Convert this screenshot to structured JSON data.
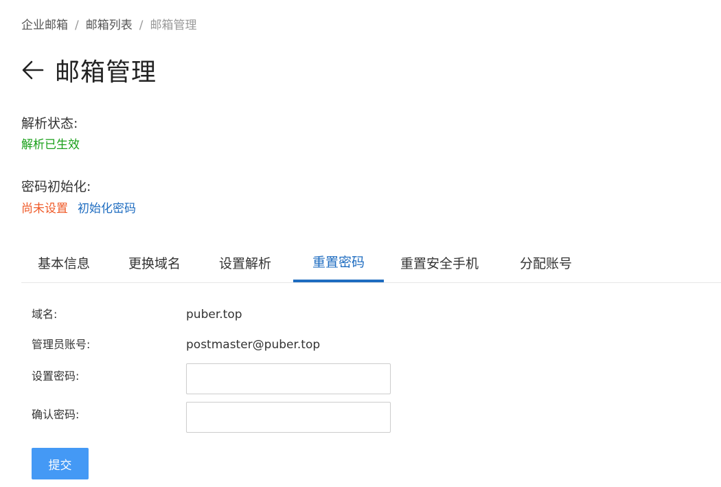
{
  "breadcrumb": {
    "items": [
      "企业邮箱",
      "邮箱列表",
      "邮箱管理"
    ],
    "separator": "/"
  },
  "page": {
    "title": "邮箱管理",
    "back_icon": "arrow-left-icon"
  },
  "resolve_status": {
    "label": "解析状态:",
    "value": "解析已生效",
    "value_color": "#19a019"
  },
  "password_init": {
    "label": "密码初始化:",
    "status": "尚未设置",
    "status_color": "#ef5a28",
    "action_link": "初始化密码"
  },
  "tabs": {
    "items": [
      "基本信息",
      "更换域名",
      "设置解析",
      "重置密码",
      "重置安全手机",
      "分配账号"
    ],
    "active": "重置密码",
    "accent_color": "#1e6cc0"
  },
  "form": {
    "domain_label": "域名:",
    "domain_value": "puber.top",
    "admin_label": "管理员账号:",
    "admin_value": "postmaster@puber.top",
    "password_label": "设置密码:",
    "password_value": "",
    "confirm_label": "确认密码:",
    "confirm_value": "",
    "submit_label": "提交",
    "submit_color": "#4499f5"
  }
}
